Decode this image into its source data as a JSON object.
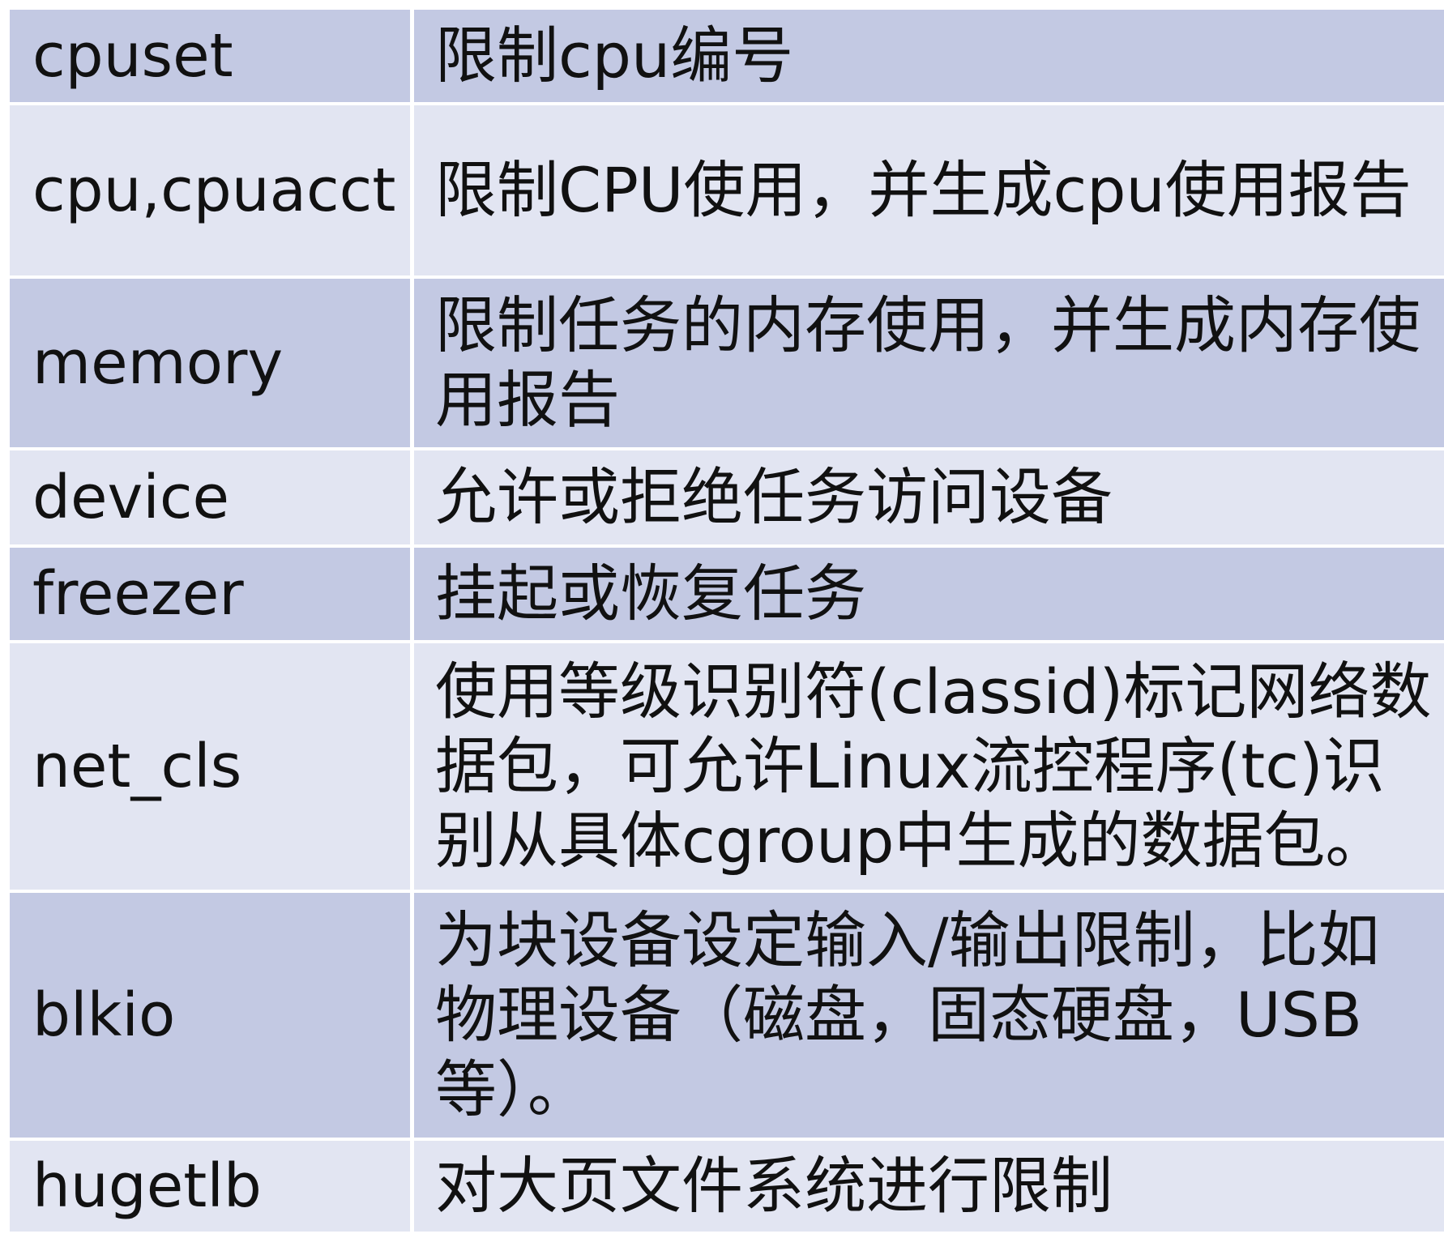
{
  "table": {
    "rows": [
      {
        "name": "cpuset",
        "description": "限制cpu编号"
      },
      {
        "name": "cpu,cpuacct",
        "description": "限制CPU使用，并生成cpu使用报告"
      },
      {
        "name": "memory",
        "description": "限制任务的内存使用，并生成内存使用报告"
      },
      {
        "name": "device",
        "description": "允许或拒绝任务访问设备"
      },
      {
        "name": "freezer",
        "description": "挂起或恢复任务"
      },
      {
        "name": "net_cls",
        "description": "使用等级识别符(classid)标记网络数据包，可允许Linux流控程序(tc)识别从具体cgroup中生成的数据包。"
      },
      {
        "name": "blkio",
        "description": "为块设备设定输入/输出限制，比如物理设备（磁盘，固态硬盘，USB等）。"
      },
      {
        "name": "hugetlb",
        "description": "对大页文件系统进行限制"
      }
    ]
  },
  "colors": {
    "row_dark": "#c3c9e3",
    "row_light": "#e2e5f2",
    "divider": "#ffffff",
    "text": "#111111"
  }
}
